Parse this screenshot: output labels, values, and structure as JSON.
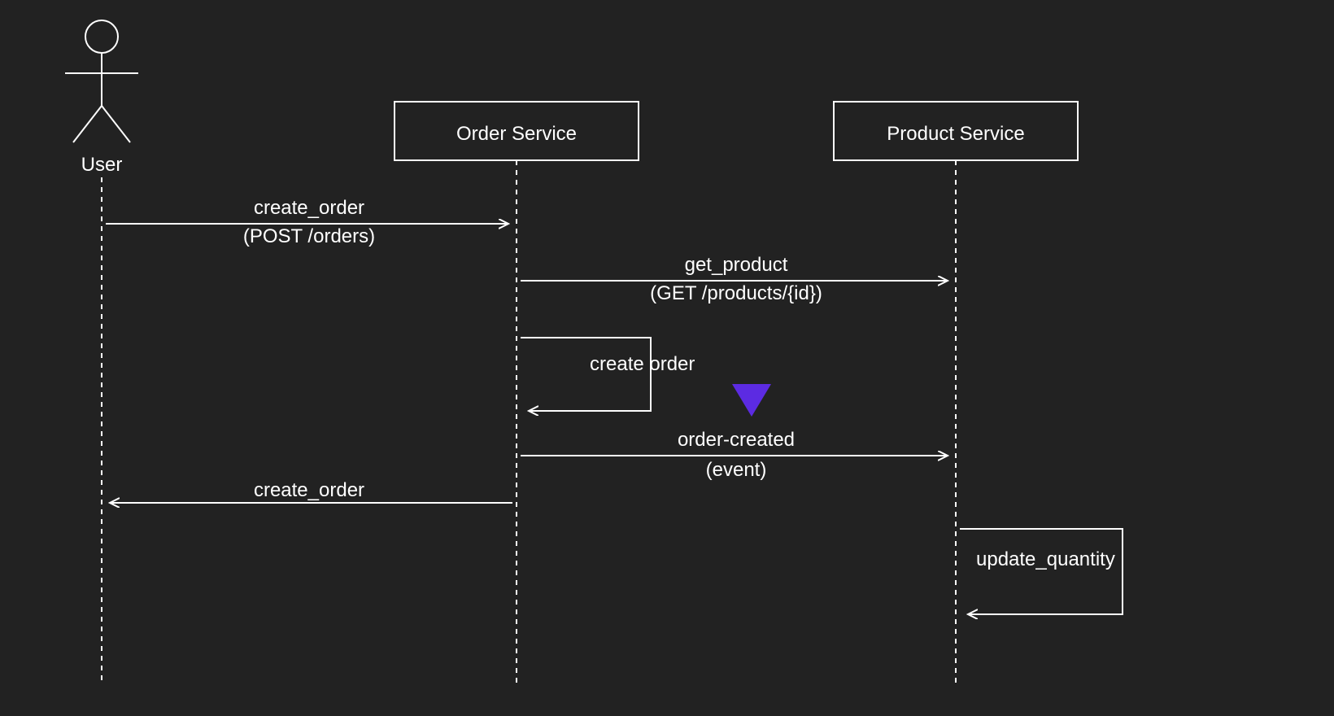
{
  "diagram": {
    "type": "sequence",
    "participants": {
      "user": {
        "label": "User",
        "type": "actor"
      },
      "order_service": {
        "label": "Order Service",
        "type": "service"
      },
      "product_service": {
        "label": "Product Service",
        "type": "service"
      }
    },
    "messages": {
      "m1": {
        "line1": "create_order",
        "line2": "(POST /orders)"
      },
      "m2": {
        "line1": "get_product",
        "line2": "(GET /products/{id})"
      },
      "m3": {
        "label": "create order"
      },
      "m4": {
        "line1": "order-created",
        "line2": "(event)"
      },
      "m5": {
        "label": "create_order"
      },
      "m6": {
        "label": "update_quantity"
      }
    },
    "colors": {
      "background": "#222222",
      "stroke": "#ffffff",
      "event_marker": "#5c2be2"
    }
  }
}
